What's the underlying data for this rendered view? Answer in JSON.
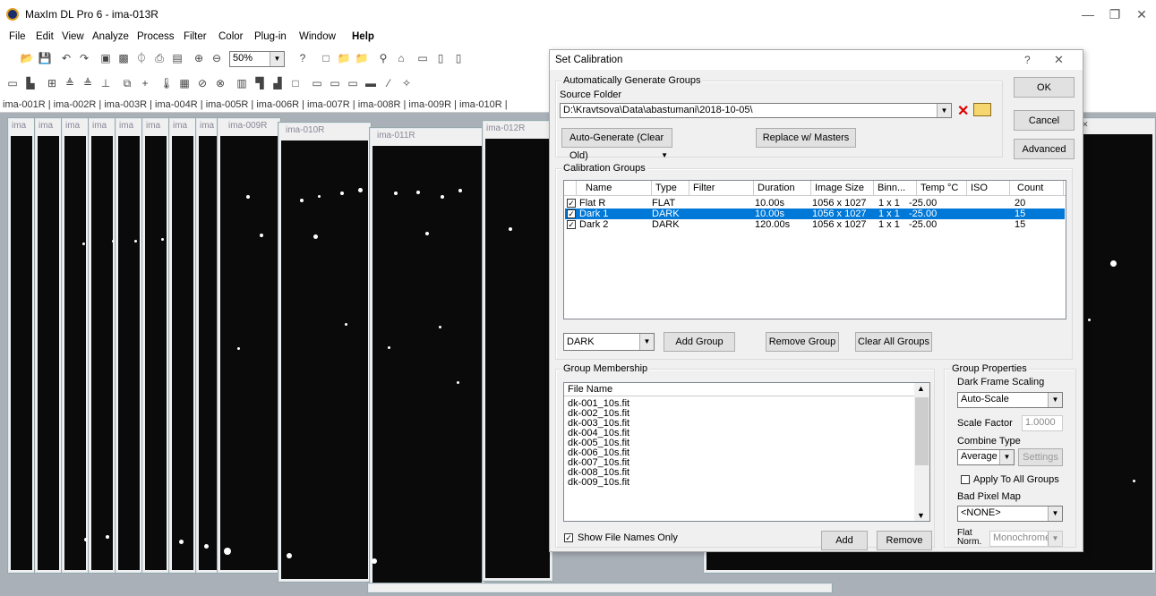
{
  "app": {
    "title": "MaxIm DL Pro 6 - ima-013R"
  },
  "menu": [
    "File",
    "Edit",
    "View",
    "Analyze",
    "Process",
    "Filter",
    "Color",
    "Plug-in",
    "Window",
    "Help"
  ],
  "toolbar": {
    "zoom": "50%"
  },
  "tabs": [
    "ima-001R",
    "ima-002R",
    "ima-003R",
    "ima-004R",
    "ima-005R",
    "ima-006R",
    "ima-007R",
    "ima-008R",
    "ima-009R",
    "ima-010R"
  ],
  "windows": [
    {
      "caption": "ima"
    },
    {
      "caption": "ima"
    },
    {
      "caption": "ima"
    },
    {
      "caption": "ima"
    },
    {
      "caption": "ima"
    },
    {
      "caption": "ima"
    },
    {
      "caption": "ima"
    },
    {
      "caption": "ima"
    },
    {
      "caption": "ima-009R"
    },
    {
      "caption": "ima-010R"
    },
    {
      "caption": "ima-011R"
    },
    {
      "caption": "ima-012R"
    }
  ],
  "dialog": {
    "title": "Set Calibration",
    "help": "?",
    "ok": "OK",
    "cancel": "Cancel",
    "advanced": "Advanced",
    "auto_group": {
      "legend": "Automatically Generate Groups",
      "source_label": "Source Folder",
      "source_value": "D:\\Kravtsova\\Data\\abastumani\\2018-10-05\\",
      "auto_generate": "Auto-Generate (Clear Old)",
      "replace": "Replace w/ Masters"
    },
    "cal_groups": {
      "legend": "Calibration Groups",
      "columns": [
        "Name",
        "Type",
        "Filter",
        "Duration",
        "Image Size",
        "Binn...",
        "Temp °C",
        "ISO",
        "Count"
      ],
      "rows": [
        {
          "name": "Flat R",
          "type": "FLAT",
          "filter": "",
          "duration": "10.00s",
          "size": "1056 x 1027",
          "binning": "1 x 1",
          "temp": "-25.00",
          "iso": "",
          "count": "20"
        },
        {
          "name": "Dark 1",
          "type": "DARK",
          "filter": "",
          "duration": "10.00s",
          "size": "1056 x 1027",
          "binning": "1 x 1",
          "temp": "-25.00",
          "iso": "",
          "count": "15"
        },
        {
          "name": "Dark 2",
          "type": "DARK",
          "filter": "",
          "duration": "120.00s",
          "size": "1056 x 1027",
          "binning": "1 x 1",
          "temp": "-25.00",
          "iso": "",
          "count": "15"
        }
      ],
      "selected_row": 1,
      "type_select": "DARK",
      "add_group": "Add Group",
      "remove_group": "Remove Group",
      "clear_all": "Clear All Groups"
    },
    "membership": {
      "legend": "Group Membership",
      "header": "File Name",
      "files": [
        "dk-001_10s.fit",
        "dk-002_10s.fit",
        "dk-003_10s.fit",
        "dk-004_10s.fit",
        "dk-005_10s.fit",
        "dk-006_10s.fit",
        "dk-007_10s.fit",
        "dk-008_10s.fit",
        "dk-009_10s.fit"
      ],
      "show_names_only": "Show File Names Only",
      "add": "Add",
      "remove": "Remove"
    },
    "props": {
      "legend": "Group Properties",
      "dark_scaling_label": "Dark Frame Scaling",
      "dark_scaling_value": "Auto-Scale",
      "scale_factor_label": "Scale Factor",
      "scale_factor_value": "1.0000",
      "combine_label": "Combine Type",
      "combine_value": "Average",
      "settings": "Settings",
      "apply_all": "Apply To All Groups",
      "bad_pixel_label": "Bad Pixel Map",
      "bad_pixel_value": "<NONE>",
      "flat_norm_label": "Flat Norm.",
      "flat_norm_value": "Monochrome"
    }
  },
  "colors": {
    "selection": "#0078d7",
    "mdi_bg": "#aab0b8",
    "image_bg": "#0a0a0a"
  }
}
